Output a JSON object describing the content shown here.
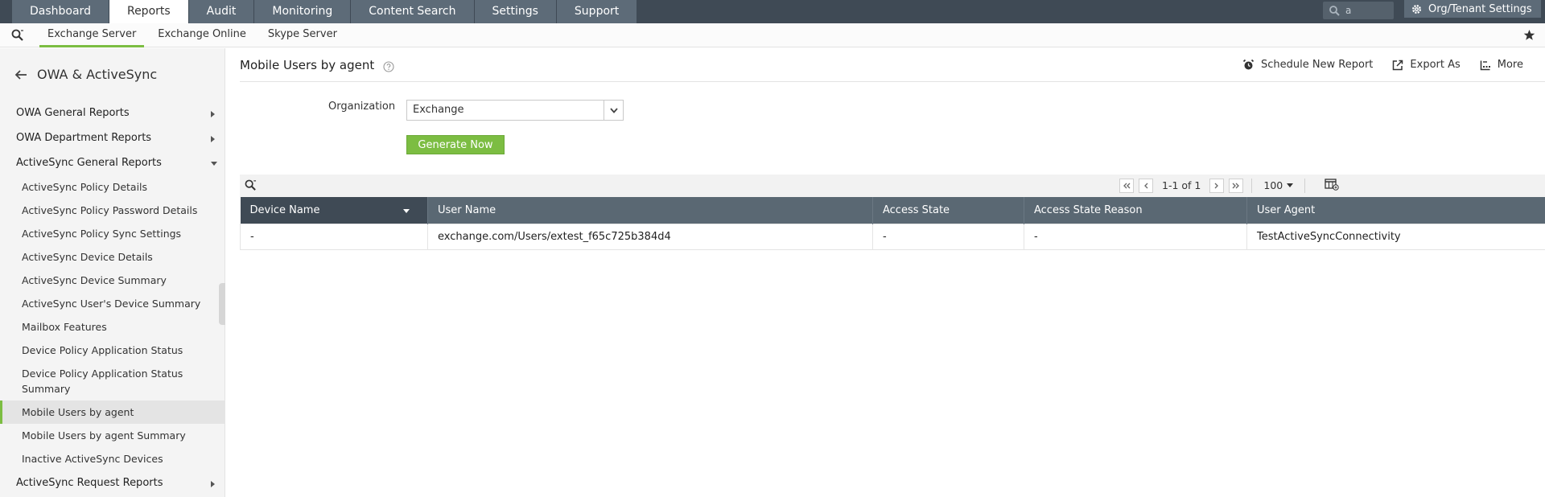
{
  "top_nav": {
    "tabs": [
      "Dashboard",
      "Reports",
      "Audit",
      "Monitoring",
      "Content Search",
      "Settings",
      "Support"
    ],
    "active_tab": "Reports",
    "search_value": "a",
    "org_settings_label": "Org/Tenant Settings"
  },
  "sub_nav": {
    "tabs": [
      "Exchange Server",
      "Exchange Online",
      "Skype Server"
    ],
    "active_tab": "Exchange Server"
  },
  "sidebar": {
    "title": "OWA & ActiveSync",
    "groups": {
      "owa_general": "OWA General Reports",
      "owa_department": "OWA Department Reports",
      "activesync_general": "ActiveSync General Reports",
      "activesync_request": "ActiveSync Request Reports"
    },
    "items": [
      "ActiveSync Policy Details",
      "ActiveSync Policy Password Details",
      "ActiveSync Policy Sync Settings",
      "ActiveSync Device Details",
      "ActiveSync Device Summary",
      "ActiveSync User's Device Summary",
      "Mailbox Features",
      "Device Policy Application Status",
      "Device Policy Application Status Summary",
      "Mobile Users by agent",
      "Mobile Users by agent Summary",
      "Inactive ActiveSync Devices"
    ],
    "active_item": "Mobile Users by agent"
  },
  "page": {
    "title": "Mobile Users by agent",
    "actions": {
      "schedule": "Schedule New Report",
      "export": "Export As",
      "more": "More"
    },
    "organization_label": "Organization",
    "organization_value": "Exchange",
    "generate_label": "Generate Now"
  },
  "grid": {
    "page_info": "1-1 of 1",
    "per_page": "100",
    "columns": [
      "Device Name",
      "User Name",
      "Access State",
      "Access State Reason",
      "User Agent"
    ],
    "rows": [
      [
        "-",
        "exchange.com/Users/extest_f65c725b384d4",
        "-",
        "-",
        "TestActiveSyncConnectivity"
      ]
    ]
  },
  "colors": {
    "nav_bg": "#3f4a55",
    "tab_bg": "#5d6b78",
    "accent_green": "#7cbd42",
    "header_dark": "#3f4a55",
    "header": "#5a6873"
  },
  "icons": [
    "search-icon",
    "gear-icon",
    "star-icon",
    "back-arrow-icon",
    "help-icon",
    "alarm-clock-icon",
    "export-icon",
    "more-icon",
    "chevron-down-icon",
    "first-page-icon",
    "prev-page-icon",
    "next-page-icon",
    "last-page-icon",
    "column-chooser-icon"
  ]
}
